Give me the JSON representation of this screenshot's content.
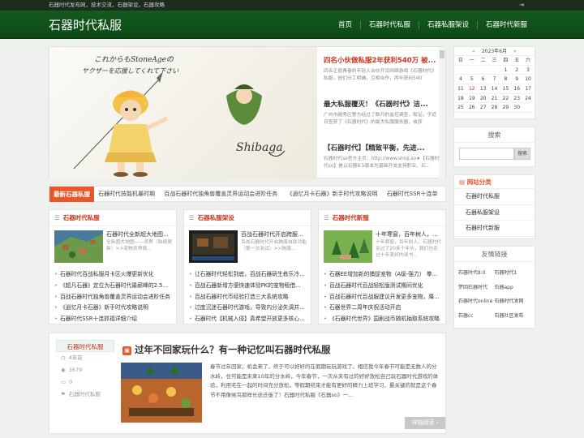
{
  "topbar": {
    "tagline": "石器时代发布网，技术交流，石器架设，石器攻略",
    "login_icon": "login-icon"
  },
  "header": {
    "logo": "石器时代私服",
    "nav": [
      "首页",
      "石器时代私服",
      "石器私服架设",
      "石器时代新服"
    ]
  },
  "slider": {
    "items": [
      {
        "title": "四名小伙做私服2年获利540万 被...",
        "desc": "四名正值青春的年轻人合伙开设网络游戏《石器时代》私服，他们分工明确，互相合作，两年获利540"
      },
      {
        "title": "最大私服覆灭！《石器时代》洁...",
        "desc": "广州市越秀区警方经过了数月的监控调查、取证，于近日查获了《石器时代》的最大私服服务器，收获"
      },
      {
        "title": "【石器时代】【精致平衡，先进...",
        "desc": "石器时代so官方主页：http://www.shiqi.so★【石器时代so】是以石器8.5版本为基础开发支持职业、石..."
      }
    ]
  },
  "ticker": {
    "label": "最新石器私服",
    "items": [
      "石器时代技能机暴时期",
      "百战石器时代独角兽覆盖灵界运动会进阶任务",
      "《逍忆月卡石器》新手时代攻略说明",
      "石器时代SSR十连单"
    ]
  },
  "categories": [
    {
      "title": "石器时代私服",
      "feature_title": "石器时代全新超大地图...",
      "feature_desc": "全新超大地图——灵界（陆续更新）>>宠物灵界挑...",
      "list": [
        "石器时代百战私服月卡区火爆更新优化",
        "《超凡石器》定位为石器时代最巅峰的2.5+...",
        "百战石器时代独角兽覆盖灵界运动会进阶任务",
        "《逍忆月卡石器》新手时代攻略说明",
        "石器时代SSR十连抓福详细介绍"
      ]
    },
    {
      "title": "石器私服架设",
      "feature_title": "百战石器时代开启跨服...",
      "feature_desc": "百战石器时代开启跨服自助功能（第一次测试）>>跨服...",
      "list": [
        "让石器时代轻松到底，百战石器研生栋乐冷为...",
        "百战石器新增方便快速体验PK的宠物租借...",
        "百战石器时代币经验打造三大系统攻略",
        "过度沉迷石器时代游戏，导致内分泌失调并...",
        "石器时代【机械入侵】真希望开放更多核心..."
      ]
    },
    {
      "title": "石器时代新服",
      "feature_title": "十年寒窗，百年树人，...",
      "feature_desc": "十年寒窗，百年树人。石器时代走过了20多个年头，我们也走过十年美好的读书...",
      "list": [
        "石器EE增加新的捕捉宠物（A级-强力） 拳...",
        "百战石器时代百战轻松版测试期间优化",
        "百战石器时代百战服建议开发更多宠物，降低玩...",
        "石器世界二周年庆祝活动开启",
        "《石器时代世界》国剧战币随机抽取系统攻略"
      ]
    }
  ],
  "article": {
    "category": "石器时代私服",
    "time": "4年前",
    "views": "3679",
    "comments": "0",
    "tag": "石器时代私服",
    "title": "过年不回家玩什么？有一种记忆叫石器时代私服",
    "text": "春节过年回家，机会来了，终于可以好好的在假期玩玩游戏了。相信我今年春节可能是无数人的分水岭，也可能是未来10年的分水岭，今年春节，一次从未有过的好好放松自己玩石器时代游戏的体验，利用宅在一起的时间充分放松。等假期结束才能有更好的精力上班学习，最关键的就是这个春节不用像候鸟那样长途迁徙了！石器时代私服《石器so》一...",
    "more": "详细阅读 ›"
  },
  "calendar": {
    "title": "2023年6月",
    "weekdays": [
      "日",
      "一",
      "二",
      "三",
      "四",
      "五",
      "六"
    ],
    "days": [
      "",
      "",
      "",
      "",
      "1",
      "2",
      "3",
      "4",
      "5",
      "6",
      "7",
      "8",
      "9",
      "10",
      "11",
      "12",
      "13",
      "14",
      "15",
      "16",
      "17",
      "18",
      "19",
      "20",
      "21",
      "22",
      "23",
      "24",
      "25",
      "26",
      "27",
      "28",
      "29",
      "30",
      ""
    ],
    "today": "12"
  },
  "search": {
    "title": "搜索",
    "placeholder": "",
    "button": "搜索"
  },
  "site_categories": {
    "title": "网站分类",
    "items": [
      "石器时代私服",
      "石器私服架设",
      "石器时代新服"
    ]
  },
  "friend_links": {
    "title": "友情链接",
    "items": [
      "石器时代8.0",
      "石器时代1",
      "梦回石器时代",
      "石器app",
      "石器时代online",
      "石器时代发网",
      "石器cc",
      "石器社区发布"
    ]
  }
}
